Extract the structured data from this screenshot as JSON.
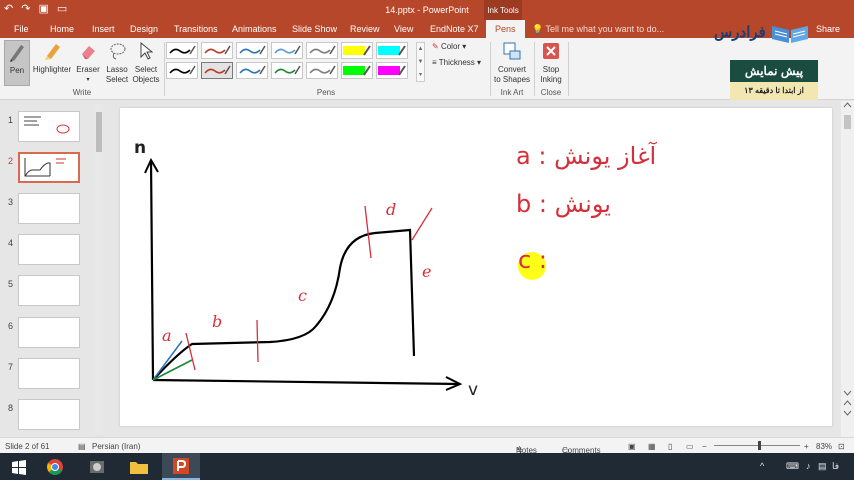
{
  "window": {
    "filename_title": "14.pptx - PowerPoint",
    "contextual_tab_group": "Ink Tools"
  },
  "tabs": [
    {
      "label": "File"
    },
    {
      "label": "Home"
    },
    {
      "label": "Insert"
    },
    {
      "label": "Design"
    },
    {
      "label": "Transitions"
    },
    {
      "label": "Animations"
    },
    {
      "label": "Slide Show"
    },
    {
      "label": "Review"
    },
    {
      "label": "View"
    },
    {
      "label": "EndNote X7"
    },
    {
      "label": "Pens"
    }
  ],
  "tell_me": "Tell me what you want to do...",
  "share_label": "Share",
  "ribbon": {
    "write": {
      "pen": "Pen",
      "highlighter": "Highlighter",
      "eraser": "Eraser",
      "lasso_1": "Lasso",
      "lasso_2": "Select",
      "select_1": "Select",
      "select_2": "Objects",
      "group": "Write"
    },
    "pens": {
      "color": "Color",
      "thickness": "Thickness",
      "group": "Pens"
    },
    "ink_art": {
      "convert_1": "Convert",
      "convert_2": "to Shapes",
      "group": "Ink Art"
    },
    "close": {
      "stop_1": "Stop",
      "stop_2": "Inking",
      "group": "Close"
    }
  },
  "pen_swatches": [
    "#000000",
    "#c0392b",
    "#2e75b6",
    "#5b9bd5",
    "#7f7f7f",
    "#ffff00",
    "#00ffff",
    "#000000",
    "#c0392b",
    "#2e75b6",
    "#1e8a3a",
    "#7f7f7f",
    "#00ff00",
    "#ff00ff"
  ],
  "promo": {
    "brand": "فرادرس",
    "title": "پیش نمایش",
    "subtitle": "از ابتدا تا دقیقه ۱۳"
  },
  "thumbnails": [
    {
      "num": "1"
    },
    {
      "num": "2"
    },
    {
      "num": "3"
    },
    {
      "num": "4"
    },
    {
      "num": "5"
    },
    {
      "num": "6"
    },
    {
      "num": "7"
    },
    {
      "num": "8"
    }
  ],
  "slide": {
    "y_axis_label": "n",
    "x_axis_label": "v",
    "region_a": "a",
    "region_b": "b",
    "region_c": "c",
    "region_d": "d",
    "region_e": "e",
    "note_a": "a : آغاز یونش",
    "note_b": "b :  یونش",
    "note_c": "c :"
  },
  "status": {
    "slide": "Slide 2 of 61",
    "language": "Persian (Iran)",
    "notes": "Notes",
    "comments": "Comments",
    "zoom": "83%"
  },
  "tray": {
    "lang": "فا"
  },
  "colors": {
    "accent": "#b7472a",
    "ink_red": "#d62f3a",
    "highlight": "#ffff00"
  }
}
